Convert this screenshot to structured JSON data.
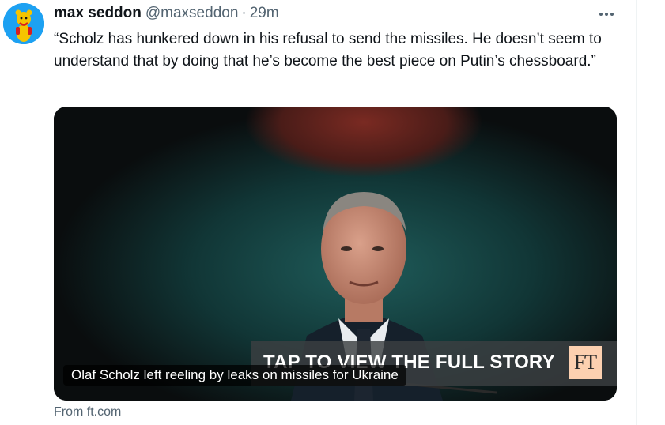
{
  "tweet": {
    "author_name": "max seddon",
    "handle": "@maxseddon",
    "separator": "·",
    "time": "29m",
    "text": "“Scholz has hunkered down in his refusal to send the missiles. He doesn’t seem to understand that by doing that he’s become the best piece on Putin’s chessboard.”",
    "more_icon": "more-horizontal-icon"
  },
  "card": {
    "cta": "TAP TO VIEW THE FULL STORY",
    "logo": "FT",
    "title": "Olaf Scholz left reeling by leaks on missiles for Ukraine",
    "source": "From ft.com"
  },
  "colors": {
    "text_primary": "#0f1419",
    "text_secondary": "#536471",
    "avatar_bg": "#1da1f2",
    "ft_logo_bg": "#fcd0b0"
  }
}
